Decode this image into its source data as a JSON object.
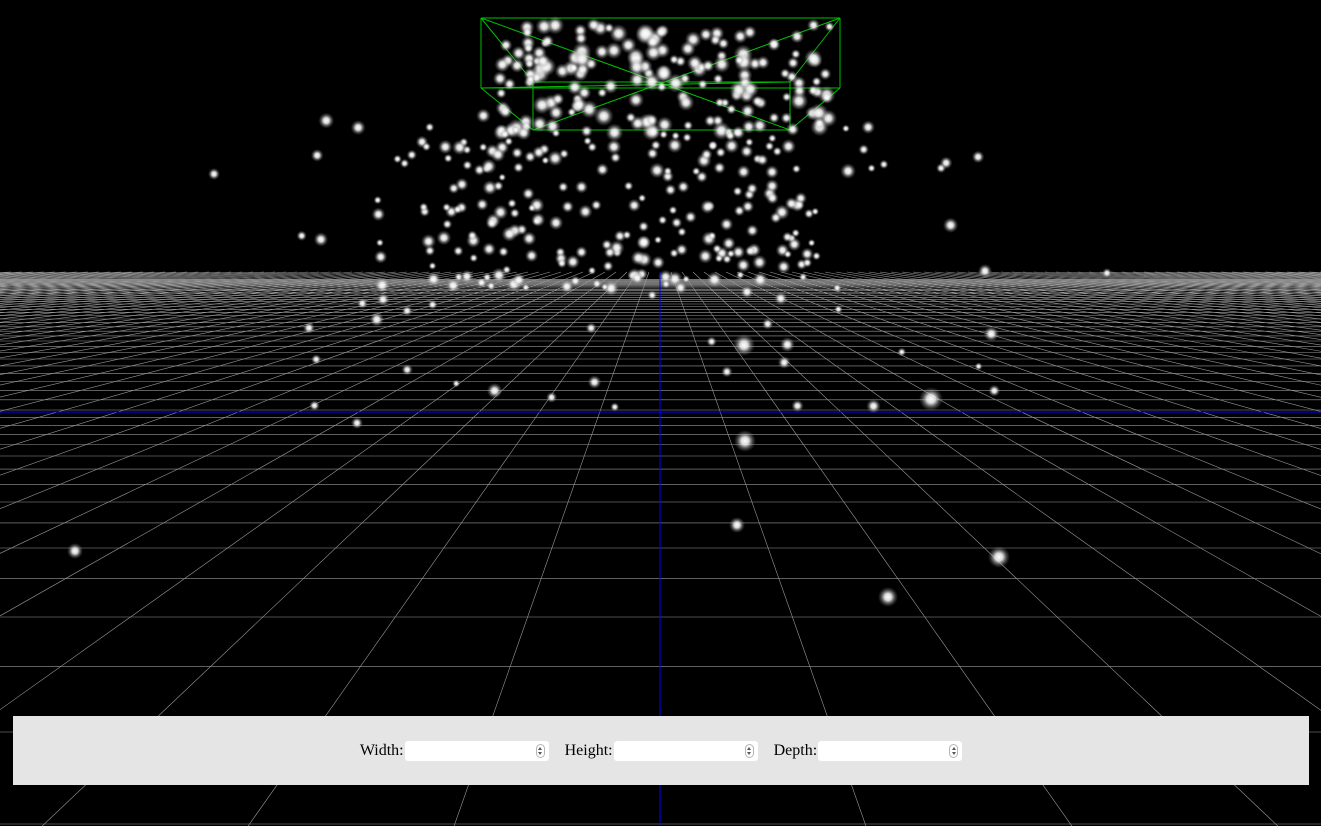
{
  "scene": {
    "background_color": "#000000",
    "grid_color": "#9a9a9a",
    "axis_color": "#0000ff",
    "bounding_box_color": "#00c000",
    "particle_color": "#ffffff"
  },
  "controls": {
    "width": {
      "label": "Width:",
      "value": ""
    },
    "height": {
      "label": "Height:",
      "value": ""
    },
    "depth": {
      "label": "Depth:",
      "value": ""
    }
  },
  "icons": {
    "spinner": "up-down-chevron-icon"
  }
}
